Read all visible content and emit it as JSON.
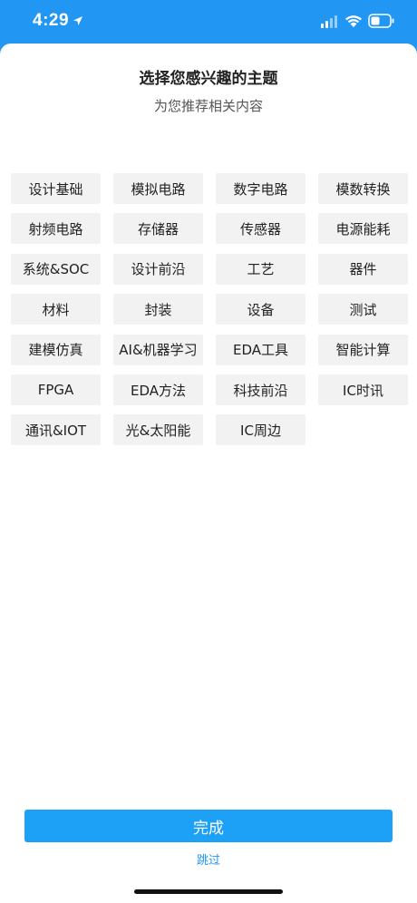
{
  "status_bar": {
    "time": "4:29",
    "icons": [
      "location-arrow-icon",
      "signal-icon",
      "wifi-icon",
      "battery-icon"
    ]
  },
  "header": {
    "title": "选择您感兴趣的主题",
    "subtitle": "为您推荐相关内容"
  },
  "topics": [
    "设计基础",
    "模拟电路",
    "数字电路",
    "模数转换",
    "射频电路",
    "存储器",
    "传感器",
    "电源能耗",
    "系统&SOC",
    "设计前沿",
    "工艺",
    "器件",
    "材料",
    "封装",
    "设备",
    "测试",
    "建模仿真",
    "AI&机器学习",
    "EDA工具",
    "智能计算",
    "FPGA",
    "EDA方法",
    "科技前沿",
    "IC时讯",
    "通讯&IOT",
    "光&太阳能",
    "IC周边"
  ],
  "actions": {
    "done_label": "完成",
    "skip_label": "跳过"
  },
  "colors": {
    "accent": "#2196f3",
    "button": "#1da1f7",
    "chip_bg": "#f2f2f2"
  }
}
